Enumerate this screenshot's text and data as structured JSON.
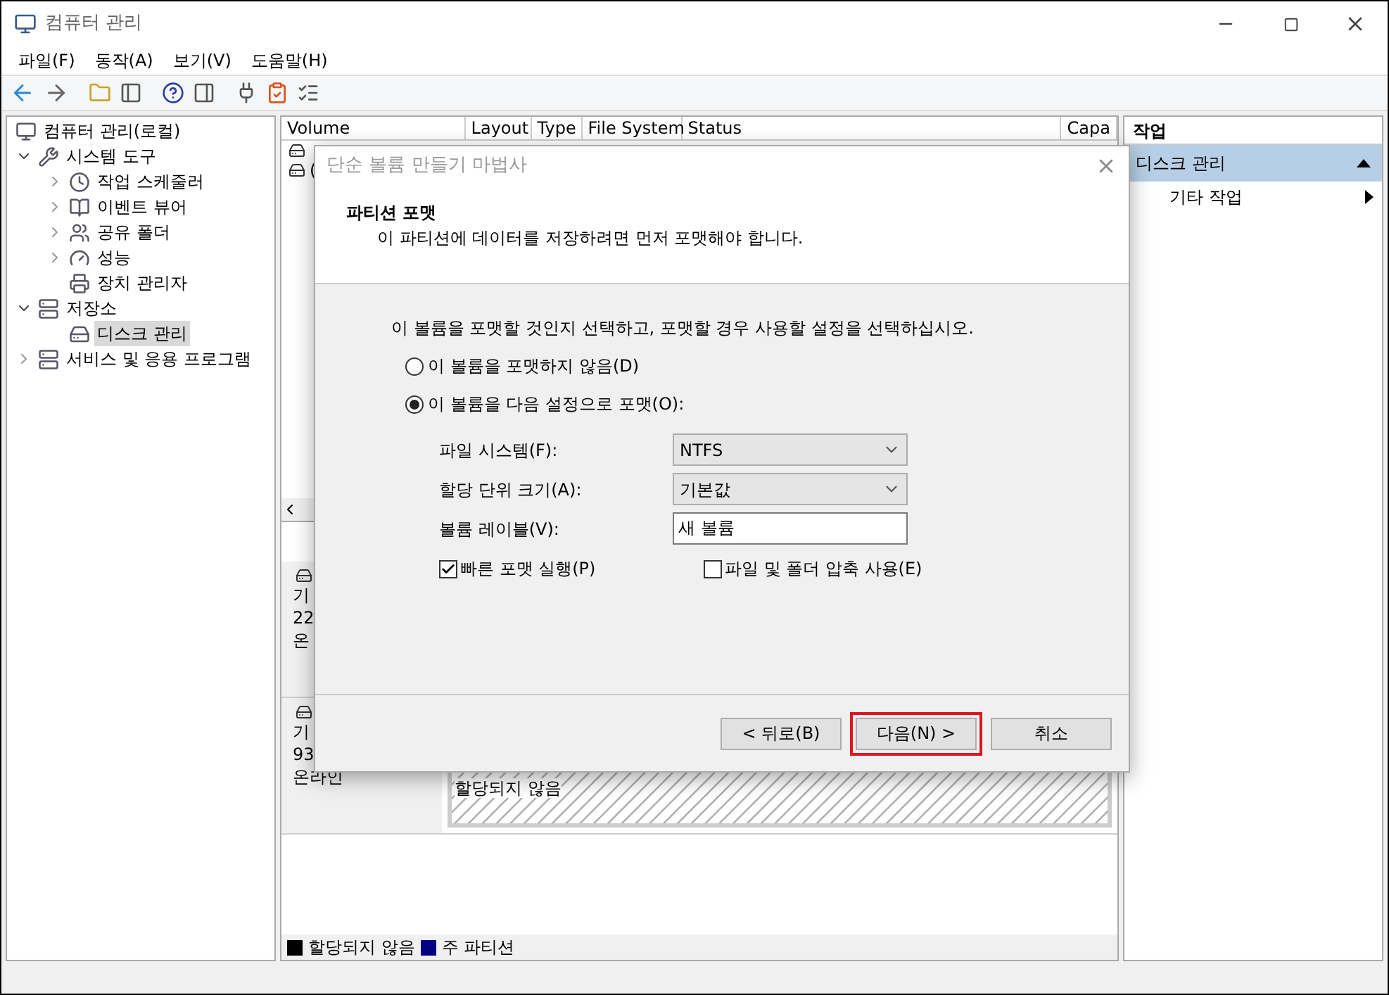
{
  "window": {
    "title": "컴퓨터 관리"
  },
  "menu": [
    "파일(F)",
    "동작(A)",
    "보기(V)",
    "도움말(H)"
  ],
  "tree": [
    {
      "label": "컴퓨터 관리(로컬)",
      "selected": false,
      "children": [
        {
          "label": "시스템 도구",
          "expanded": true,
          "selected": false,
          "children": [
            {
              "label": "작업 스케줄러",
              "expanded": false,
              "selected": false
            },
            {
              "label": "이벤트 뷰어",
              "expanded": false,
              "selected": false
            },
            {
              "label": "공유 폴더",
              "expanded": false,
              "selected": false
            },
            {
              "label": "성능",
              "expanded": false,
              "selected": false
            },
            {
              "label": "장치 관리자",
              "selected": false
            }
          ]
        },
        {
          "label": "저장소",
          "expanded": true,
          "selected": false,
          "children": [
            {
              "label": "디스크 관리",
              "selected": true
            }
          ]
        },
        {
          "label": "서비스 및 응용 프로그램",
          "expanded": false,
          "selected": false
        }
      ]
    }
  ],
  "volume_table": {
    "columns": [
      "Volume",
      "Layout",
      "Type",
      "File System",
      "Status",
      "Capa"
    ],
    "rows": [
      {
        "volume": ""
      },
      {
        "volume": "("
      }
    ]
  },
  "disks": [
    {
      "lines": [
        "기",
        "22",
        "온"
      ]
    },
    {
      "lines": [
        "기",
        "93",
        "온라인"
      ],
      "partition": "할당되지 않음"
    }
  ],
  "legend": [
    {
      "label": "할당되지 않음",
      "color": "#000000"
    },
    {
      "label": "주 파티션",
      "color": "#000080"
    }
  ],
  "actions": {
    "header": "작업",
    "section": "디스크 관리",
    "expanded": true,
    "items": [
      "기타 작업"
    ]
  },
  "dialog": {
    "title": "단순 볼륨 만들기 마법사",
    "heading": "파티션 포맷",
    "subtitle": "이 파티션에 데이터를 저장하려면 먼저 포맷해야 합니다.",
    "prompt": "이 볼륨을 포맷할 것인지 선택하고, 포맷할 경우 사용할 설정을 선택하십시오.",
    "radios": [
      {
        "label": "이 볼륨을 포맷하지 않음(D)",
        "selected": false
      },
      {
        "label": "이 볼륨을 다음 설정으로 포맷(O):",
        "selected": true
      }
    ],
    "fields": [
      {
        "label": "파일 시스템(F):",
        "kind": "select",
        "value": "NTFS"
      },
      {
        "label": "할당 단위 크기(A):",
        "kind": "select",
        "value": "기본값"
      },
      {
        "label": "볼륨 레이블(V):",
        "kind": "text",
        "value": "새 볼륨"
      }
    ],
    "checkboxes": [
      {
        "label": "빠른 포맷 실행(P)",
        "checked": true
      },
      {
        "label": "파일 및 폴더 압축 사용(E)",
        "checked": false
      }
    ],
    "buttons": [
      {
        "label": "< 뒤로(B)",
        "highlighted": false
      },
      {
        "label": "다음(N) >",
        "highlighted": true
      },
      {
        "label": "취소",
        "highlighted": false
      }
    ]
  }
}
